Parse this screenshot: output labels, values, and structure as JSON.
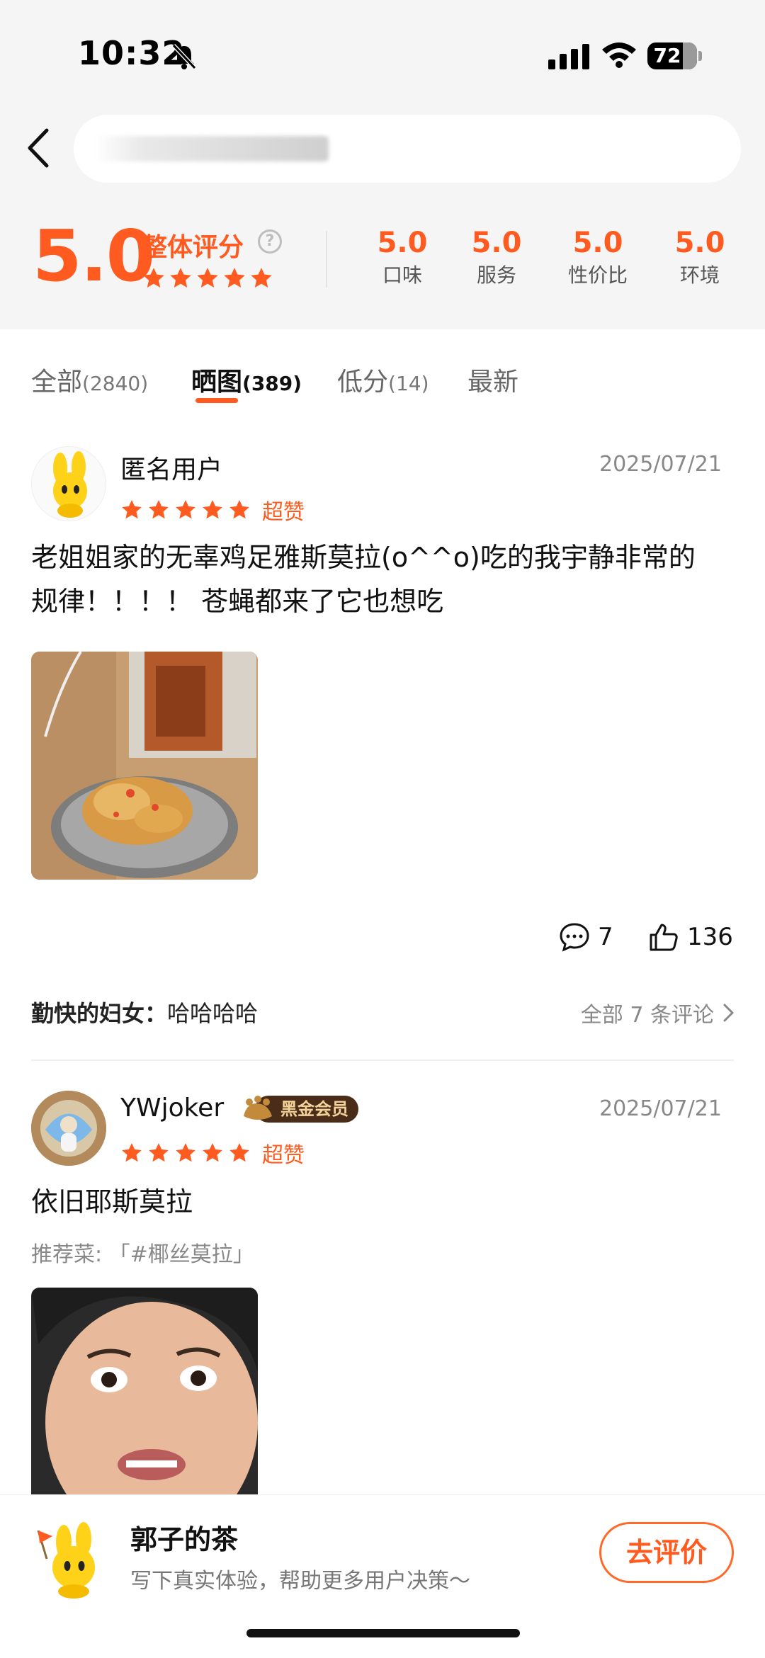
{
  "status_bar": {
    "time": "10:32",
    "battery": "72"
  },
  "summary": {
    "overall_score": "5.0",
    "overall_label": "整体评分",
    "help_glyph": "?",
    "stars": 5,
    "subscores": [
      {
        "value": "5.0",
        "label": "口味"
      },
      {
        "value": "5.0",
        "label": "服务"
      },
      {
        "value": "5.0",
        "label": "性价比"
      },
      {
        "value": "5.0",
        "label": "环境"
      }
    ]
  },
  "tabs": [
    {
      "label": "全部",
      "count": "(2840)"
    },
    {
      "label": "晒图",
      "count": "(389)"
    },
    {
      "label": "低分",
      "count": "(14)"
    },
    {
      "label": "最新",
      "count": ""
    }
  ],
  "active_tab": "晒图",
  "reviews": [
    {
      "user": "匿名用户",
      "date": "2025/07/21",
      "stars": 5,
      "tag": "超赞",
      "text_line1": "老姐姐家的无辜鸡足雅斯莫拉(o^^o)吃的我宇静非常的",
      "text_line2": "规律！！！！ 苍蝇都来了它也想吃",
      "comments": "7",
      "likes": "136",
      "top_comment_user": "勤快的妇女：",
      "top_comment_text": "哈哈哈哈",
      "all_comments_label": "全部 7 条评论"
    },
    {
      "user": "YWjoker",
      "badge": "黑金会员",
      "date": "2025/07/21",
      "stars": 5,
      "tag": "超赞",
      "text": "依旧耶斯莫拉",
      "recommend": "推荐菜: 「#椰丝莫拉」"
    }
  ],
  "bottom_bar": {
    "shop_name": "郭子的茶",
    "hint": "写下真实体验，帮助更多用户决策～",
    "button": "去评价"
  },
  "colors": {
    "accent": "#ff5a1f",
    "background": "#f5f5f5"
  }
}
